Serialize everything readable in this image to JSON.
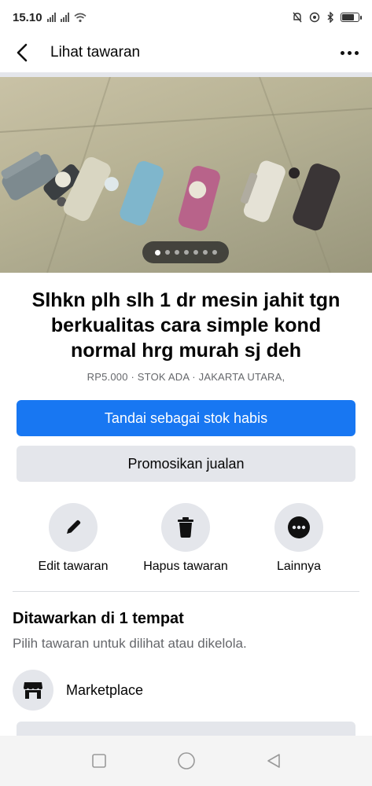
{
  "status_bar": {
    "time": "15.10",
    "battery_level": 0.8
  },
  "header": {
    "title": "Lihat tawaran",
    "back_icon": "chevron-left-icon",
    "more_icon": "more-horizontal-icon"
  },
  "photo": {
    "pager_total": 7,
    "pager_active": 0
  },
  "listing": {
    "title": "Slhkn plh slh 1 dr mesin jahit tgn berkualitas cara simple kond normal hrg murah sj deh",
    "meta": "RP5.000 · STOK ADA · JAKARTA UTARA,"
  },
  "buttons": {
    "mark_sold": "Tandai sebagai stok habis",
    "promote": "Promosikan jualan"
  },
  "actions": [
    {
      "label": "Edit tawaran",
      "icon": "pencil-icon"
    },
    {
      "label": "Hapus tawaran",
      "icon": "trash-icon"
    },
    {
      "label": "Lainnya",
      "icon": "more-icon"
    }
  ],
  "offered": {
    "title": "Ditawarkan di 1 tempat",
    "subtitle": "Pilih tawaran untuk dilihat atau dikelola.",
    "places": [
      {
        "label": "Marketplace",
        "icon": "storefront-icon"
      }
    ]
  },
  "colors": {
    "primary": "#1877f2",
    "secondary_bg": "#e4e6eb",
    "text": "#050505",
    "muted": "#65676b"
  }
}
